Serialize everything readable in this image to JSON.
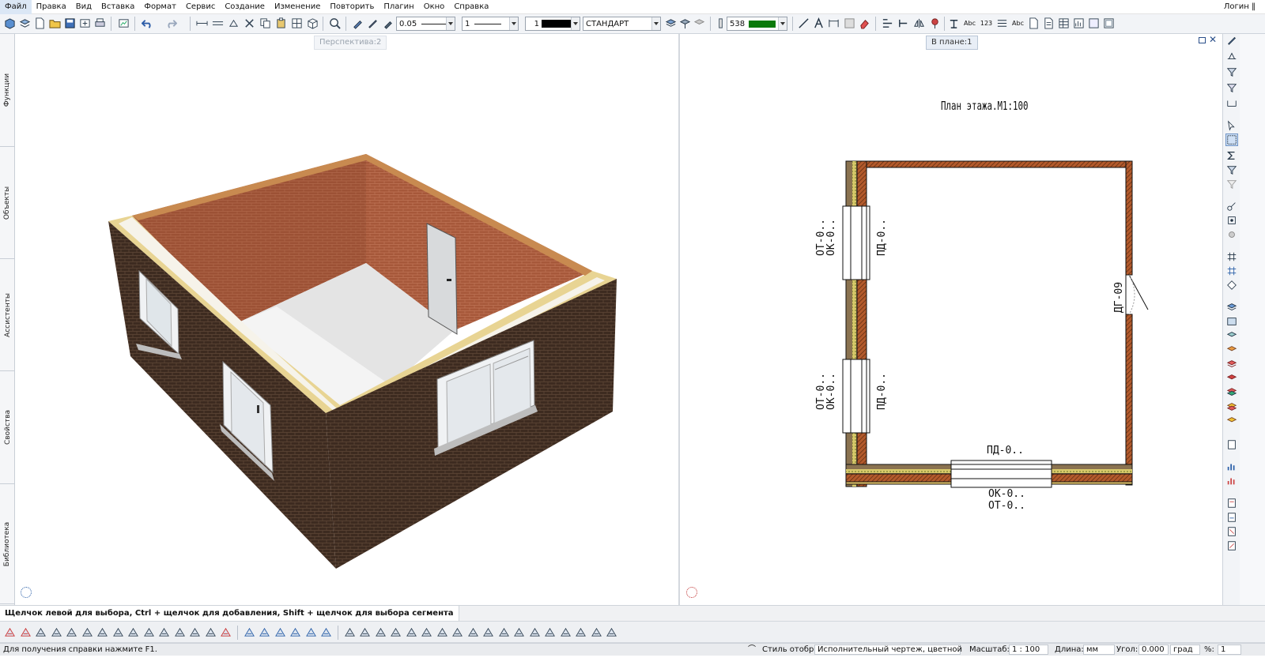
{
  "menu": [
    "Файл",
    "Правка",
    "Вид",
    "Вставка",
    "Формат",
    "Сервис",
    "Создание",
    "Изменение",
    "Повторить",
    "Плагин",
    "Окно",
    "Справка"
  ],
  "user_label": "Логин",
  "toolbar": {
    "line_weight": "0.05",
    "line_type": "1",
    "color_index": "1",
    "style": "СТАНДАРТ",
    "layer_value": "538",
    "text_abc": "Abc",
    "text_123": "123",
    "text_abc2": "Abc"
  },
  "left_tabs": [
    "Функции",
    "Объекты",
    "Ассистенты",
    "Свойства",
    "Библиотека"
  ],
  "viewports": {
    "left_title": "Перспектива:2",
    "right_title": "В плане:1"
  },
  "plan": {
    "title": "План этажа.М1:100",
    "labels": {
      "ot1": "ОТ-0..",
      "ok1": "ОК-0..",
      "pd1": "ПД-0..",
      "ot2": "ОТ-0..",
      "ok2": "ОК-0..",
      "pd2": "ПД-0..",
      "door": "ДГ-09",
      "pd3": "ПД-0..",
      "ok3": "ОК-0..",
      "ot3": "ОТ-0.."
    }
  },
  "hint": "Щелчок левой для выбора, Ctrl + щелчок для добавления, Shift + щелчок для выбора сегмента",
  "status": {
    "help": "Для получения справки нажмите F1.",
    "display_style_label": "Стиль отобр.:",
    "display_style_value": "Исполнительный чертеж, цветной",
    "scale_label": "Масштаб:",
    "scale_value": "1 : 100",
    "length_label": "Длина:",
    "length_unit": "мм",
    "angle_label": "Угол:",
    "angle_value": "0.000",
    "angle_unit": "град",
    "percent_label": "%:",
    "percent_value": "1"
  },
  "colors": {
    "accent": "#0a7a0a",
    "brick_outer": "#3a2a20",
    "brick_inner": "#a8583a",
    "insulation": "#e6d48a"
  }
}
